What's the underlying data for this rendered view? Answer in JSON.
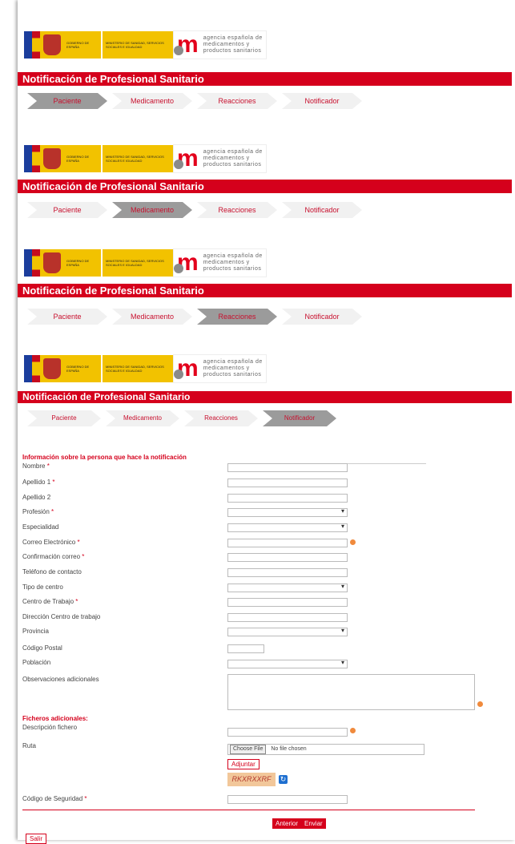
{
  "header": {
    "gov_text": "GOBIERNO DE ESPAÑA",
    "ministry_text": "MINISTERIO DE SANIDAD, SERVICIOS SOCIALES E IGUALDAD",
    "agency_text_1": "agencia española de",
    "agency_text_2": "medicamentos y",
    "agency_text_3": "productos sanitarios"
  },
  "page_title": "Notificación de Profesional Sanitario",
  "steps": [
    "Paciente",
    "Medicamento",
    "Reacciones",
    "Notificador"
  ],
  "form": {
    "section_title": "Información sobre la persona que hace la notificación",
    "fields": [
      {
        "label": "Nombre",
        "required": true,
        "type": "input"
      },
      {
        "label": "Apellido 1",
        "required": true,
        "type": "input"
      },
      {
        "label": "Apellido 2",
        "required": false,
        "type": "input"
      },
      {
        "label": "Profesión",
        "required": true,
        "type": "select"
      },
      {
        "label": "Especialidad",
        "required": false,
        "type": "select"
      },
      {
        "label": "Correo Electrónico",
        "required": true,
        "type": "input"
      },
      {
        "label": "Confirmación correo",
        "required": true,
        "type": "input"
      },
      {
        "label": "Teléfono de contacto",
        "required": false,
        "type": "input"
      },
      {
        "label": "Tipo de centro",
        "required": false,
        "type": "select"
      },
      {
        "label": "Centro de Trabajo",
        "required": true,
        "type": "input"
      },
      {
        "label": "Dirección Centro de trabajo",
        "required": false,
        "type": "input"
      },
      {
        "label": "Provincia",
        "required": false,
        "type": "select"
      }
    ],
    "postal_label": "Código Postal",
    "poblacion_label": "Población",
    "observaciones_label": "Observaciones adicionales",
    "ficheros_title": "Ficheros adicionales:",
    "descripcion_label": "Descripción fichero",
    "ruta_label": "Ruta",
    "choose_file": "Choose File",
    "no_file": "No file chosen",
    "adjuntar": "Adjuntar",
    "captcha_text": "RKXRXXRF",
    "codigo_label": "Código de Seguridad",
    "anterior": "Anterior",
    "enviar": "Enviar",
    "salir": "Salir"
  },
  "colors": {
    "brand_red": "#d5001c",
    "step_active": "#9b9b9b",
    "step_inactive": "#f1f1f1"
  }
}
